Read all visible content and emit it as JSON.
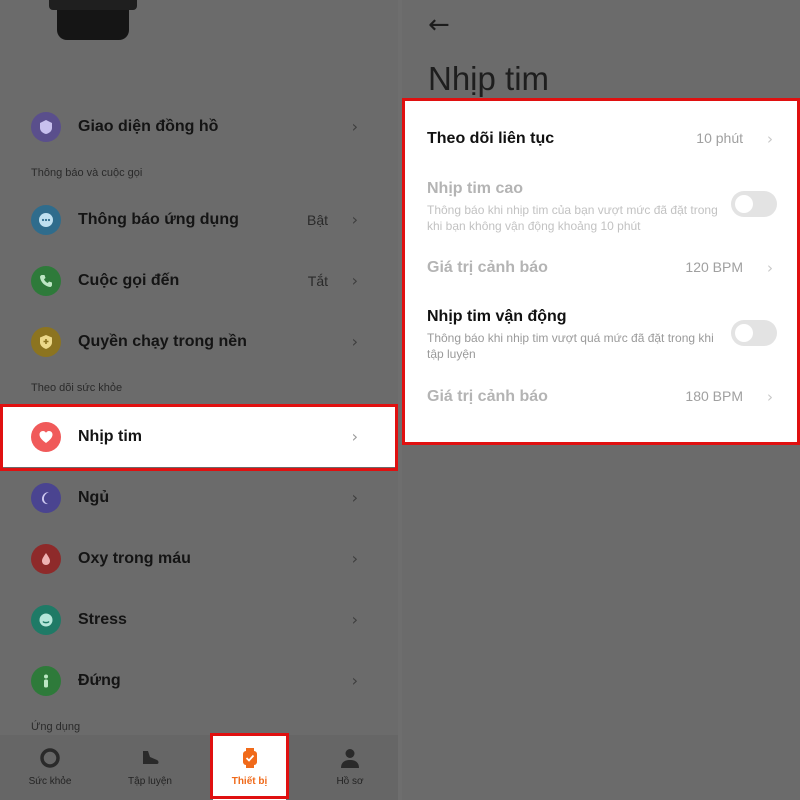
{
  "left": {
    "items_top": [
      {
        "label": "Giao diện đồng hồ",
        "value": "",
        "icon": "watch-face-icon",
        "color": "#5a4f8c"
      }
    ],
    "section_notify": "Thông báo và cuộc gọi",
    "items_notify": [
      {
        "label": "Thông báo ứng dụng",
        "value": "Bật",
        "icon": "chat-icon",
        "color": "#2f6c8c"
      },
      {
        "label": "Cuộc gọi đến",
        "value": "Tắt",
        "icon": "phone-icon",
        "color": "#2e7a3a"
      },
      {
        "label": "Quyền chạy trong nền",
        "value": "",
        "icon": "shield-icon",
        "color": "#8c7420"
      }
    ],
    "section_health": "Theo dõi sức khỏe",
    "heart": {
      "label": "Nhịp tim",
      "value": "",
      "icon": "heart-icon",
      "color": "#f05a5a"
    },
    "items_health": [
      {
        "label": "Ngủ",
        "value": "",
        "icon": "moon-icon",
        "color": "#4a4490"
      },
      {
        "label": "Oxy trong máu",
        "value": "",
        "icon": "drop-icon",
        "color": "#8e2a2a"
      },
      {
        "label": "Stress",
        "value": "",
        "icon": "stress-icon",
        "color": "#1f7a66"
      },
      {
        "label": "Đứng",
        "value": "",
        "icon": "standing-icon",
        "color": "#2e7a3a"
      }
    ],
    "section_apps": "Ứng dụng",
    "nav": [
      {
        "label": "Sức khỏe",
        "icon": "health-ring-icon"
      },
      {
        "label": "Tập luyện",
        "icon": "shoe-icon"
      },
      {
        "label": "Thiết bị",
        "icon": "watch-icon"
      },
      {
        "label": "Hồ sơ",
        "icon": "profile-icon"
      }
    ]
  },
  "right": {
    "back_symbol": "←",
    "title": "Nhịp tim",
    "continuous": {
      "label": "Theo dõi liên tục",
      "value": "10 phút"
    },
    "high": {
      "label": "Nhịp tim cao",
      "desc": "Thông báo khi nhịp tim của bạn vượt mức đã đặt trong khi bạn không vận động khoảng 10 phút",
      "enabled": false
    },
    "alert1": {
      "label": "Giá trị cảnh báo",
      "value": "120 BPM"
    },
    "exercise": {
      "label": "Nhịp tim vận động",
      "desc": "Thông báo khi nhịp tim vượt quá mức đã đặt trong khi tập luyện",
      "enabled": false
    },
    "alert2": {
      "label": "Giá trị cảnh báo",
      "value": "180 BPM"
    }
  },
  "colors": {
    "highlight": "#e01010",
    "accent": "#f06a1a"
  }
}
